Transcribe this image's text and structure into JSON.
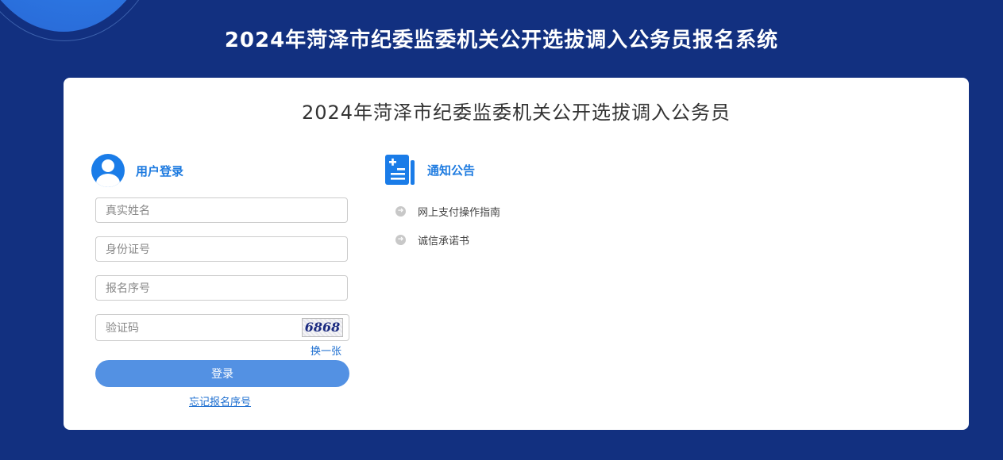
{
  "site": {
    "title": "2024年菏泽市纪委监委机关公开选拔调入公务员报名系统"
  },
  "panel": {
    "title": "2024年菏泽市纪委监委机关公开选拔调入公务员"
  },
  "login": {
    "heading": "用户登录",
    "name_placeholder": "真实姓名",
    "id_placeholder": "身份证号",
    "seq_placeholder": "报名序号",
    "code_placeholder": "验证码",
    "captcha_text": "6868",
    "refresh_label": "换一张",
    "submit_label": "登录",
    "forgot_label": "忘记报名序号"
  },
  "notices": {
    "heading": "通知公告",
    "items": [
      {
        "label": "网上支付操作指南"
      },
      {
        "label": "诚信承诺书"
      }
    ]
  },
  "icons": {
    "login": "user-icon",
    "notices": "document-icon",
    "notice_item": "arrow-right-circle-icon"
  },
  "colors": {
    "background": "#123080",
    "accent": "#1e7be0",
    "button": "#5391e3"
  }
}
